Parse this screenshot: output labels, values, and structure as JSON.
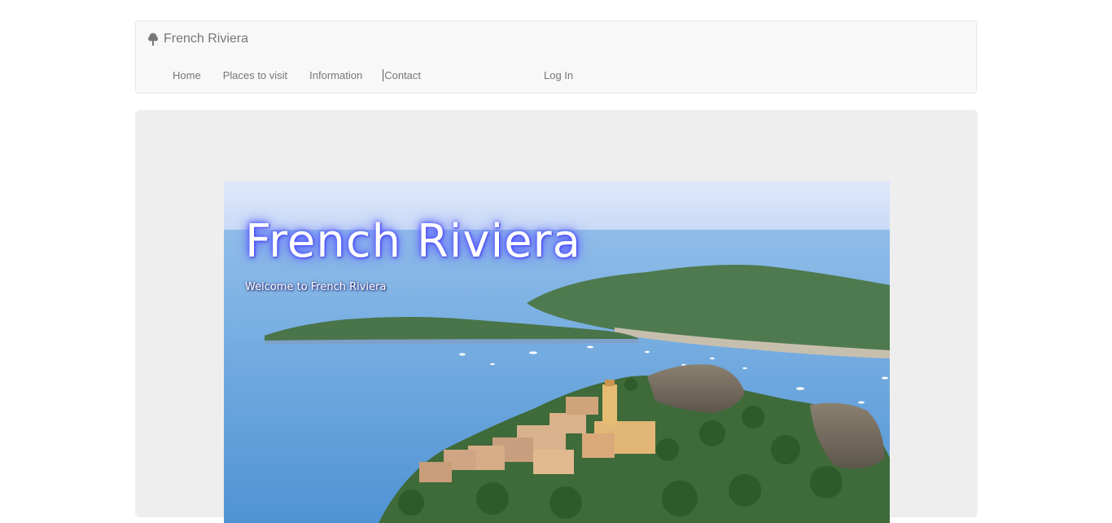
{
  "navbar": {
    "brand": "French Riviera",
    "brand_icon": "tree-icon",
    "links": [
      "Home",
      "Places to visit",
      "Information",
      "Contact"
    ],
    "login": "Log In"
  },
  "hero": {
    "title": "French Riviera",
    "subtitle": "Welcome to French Riviera"
  },
  "colors": {
    "navbar_bg": "#f8f8f8",
    "nav_text": "#777777",
    "jumbotron_bg": "#eeeeee",
    "title_glow": "#4a4cff"
  }
}
